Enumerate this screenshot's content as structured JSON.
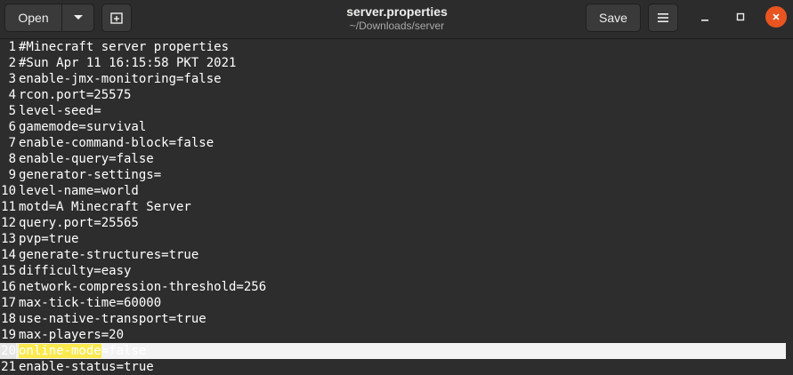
{
  "headerbar": {
    "open_label": "Open",
    "save_label": "Save",
    "title": "server.properties",
    "subtitle": "~/Downloads/server"
  },
  "colors": {
    "close_button": "#e95420",
    "highlight": "#fce94f",
    "editor_bg": "#2d2d2d",
    "current_line_bg": "#f3f3f3"
  },
  "editor": {
    "lines": [
      {
        "n": "1",
        "text": "#Minecraft server properties"
      },
      {
        "n": "2",
        "text": "#Sun Apr 11 16:15:58 PKT 2021"
      },
      {
        "n": "3",
        "text": "enable-jmx-monitoring=false"
      },
      {
        "n": "4",
        "text": "rcon.port=25575"
      },
      {
        "n": "5",
        "text": "level-seed="
      },
      {
        "n": "6",
        "text": "gamemode=survival"
      },
      {
        "n": "7",
        "text": "enable-command-block=false"
      },
      {
        "n": "8",
        "text": "enable-query=false"
      },
      {
        "n": "9",
        "text": "generator-settings="
      },
      {
        "n": "10",
        "text": "level-name=world"
      },
      {
        "n": "11",
        "text": "motd=A Minecraft Server"
      },
      {
        "n": "12",
        "text": "query.port=25565"
      },
      {
        "n": "13",
        "text": "pvp=true"
      },
      {
        "n": "14",
        "text": "generate-structures=true"
      },
      {
        "n": "15",
        "text": "difficulty=easy"
      },
      {
        "n": "16",
        "text": "network-compression-threshold=256"
      },
      {
        "n": "17",
        "text": "max-tick-time=60000"
      },
      {
        "n": "18",
        "text": "use-native-transport=true"
      },
      {
        "n": "19",
        "text": "max-players=20"
      }
    ],
    "current_line": {
      "n": "20",
      "selected": "online-mode",
      "rest": "=false"
    },
    "after_lines": [
      {
        "n": "21",
        "text": "enable-status=true"
      }
    ]
  }
}
